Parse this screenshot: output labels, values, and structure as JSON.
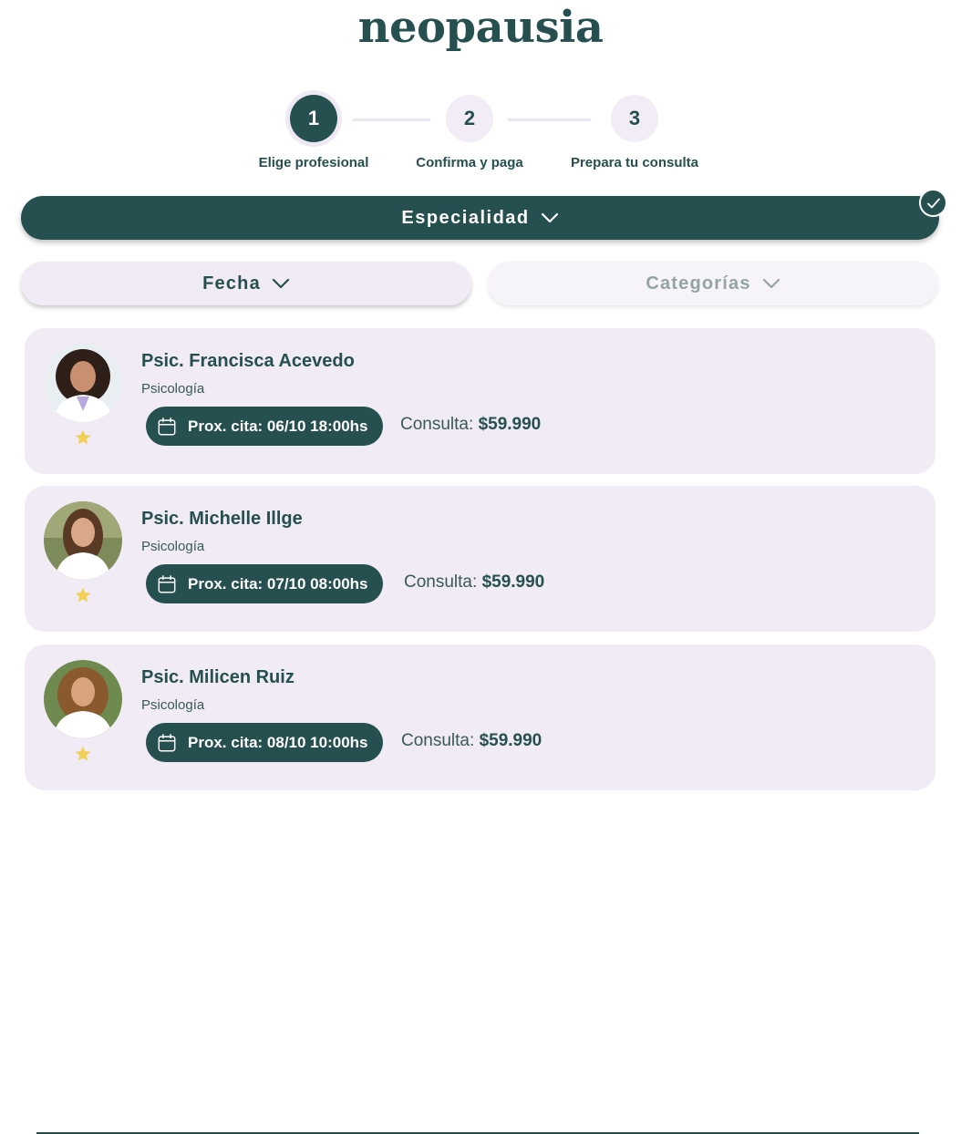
{
  "brand": {
    "logo": "neopausia"
  },
  "stepper": {
    "steps": [
      {
        "number": "1",
        "label": "Elige profesional",
        "active": true
      },
      {
        "number": "2",
        "label": "Confirma y paga",
        "active": false
      },
      {
        "number": "3",
        "label": "Prepara tu consulta",
        "active": false
      }
    ]
  },
  "filters": {
    "especialidad": "Especialidad",
    "fecha": "Fecha",
    "categorias": "Categorías"
  },
  "professionals": [
    {
      "name": "Psic. Francisca Acevedo",
      "specialty": "Psicología",
      "appointment": "Prox. cita: 06/10 18:00hs",
      "price_label": "Consulta:",
      "price": "$59.990"
    },
    {
      "name": "Psic. Michelle Illge",
      "specialty": "Psicología",
      "appointment": "Prox. cita: 07/10 08:00hs",
      "price_label": "Consulta:",
      "price": "$59.990"
    },
    {
      "name": "Psic. Milicen Ruiz",
      "specialty": "Psicología",
      "appointment": "Prox. cita: 08/10 10:00hs",
      "price_label": "Consulta:",
      "price": "$59.990"
    }
  ],
  "colors": {
    "primary": "#264f4f",
    "card_bg": "#f0ebf5",
    "star": "#f2cf55"
  },
  "icons": {
    "appointment": "calendar-icon",
    "rating": "star-icon",
    "dropdown": "chevron-down-icon",
    "selected": "check-icon"
  }
}
